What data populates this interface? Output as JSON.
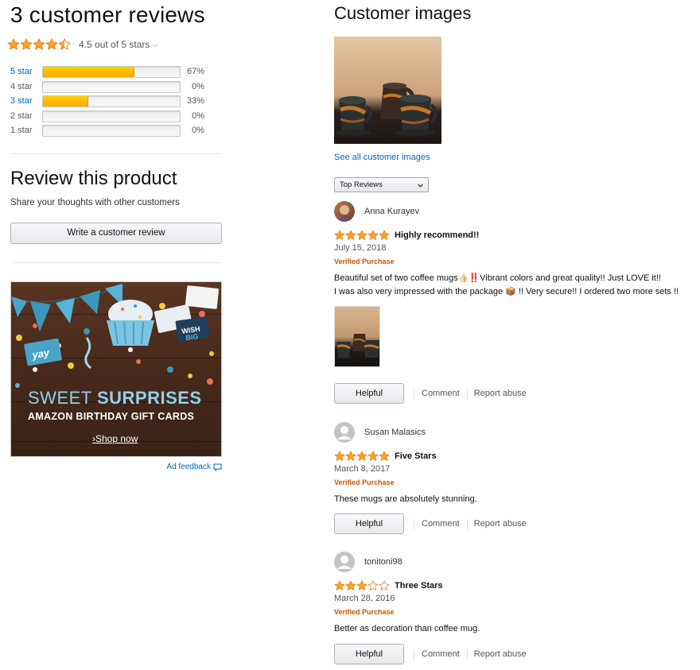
{
  "summary": {
    "title": "3 customer reviews",
    "rating_value": 4.5,
    "rating_text": "4.5 out of 5 stars",
    "histogram": [
      {
        "label": "5 star",
        "percent": 67,
        "percent_text": "67%",
        "linked": true
      },
      {
        "label": "4 star",
        "percent": 0,
        "percent_text": "0%",
        "linked": false
      },
      {
        "label": "3 star",
        "percent": 33,
        "percent_text": "33%",
        "linked": true
      },
      {
        "label": "2 star",
        "percent": 0,
        "percent_text": "0%",
        "linked": false
      },
      {
        "label": "1 star",
        "percent": 0,
        "percent_text": "0%",
        "linked": false
      }
    ]
  },
  "review_product": {
    "title": "Review this product",
    "subtitle": "Share your thoughts with other customers",
    "button_label": "Write a customer review"
  },
  "ad": {
    "headline_light": "SWEET ",
    "headline_bold": "SURPRISES",
    "subline": "AMAZON BIRTHDAY GIFT CARDS",
    "cta": "Shop now",
    "feedback_label": "Ad feedback"
  },
  "customer_images": {
    "title": "Customer images",
    "see_all": "See all customer images"
  },
  "sort": {
    "selected": "Top Reviews"
  },
  "reviews": [
    {
      "author": "Anna Kurayev",
      "stars": 5,
      "title": "Highly recommend!!",
      "date": "July 15, 2018",
      "verified": "Verified Purchase",
      "body_line1": "Beautiful set of two coffee mugs👍🏻‼️Vibrant colors and great quality!! Just LOVE it!!",
      "body_line2": "I was also very impressed with the package 📦 !! Very secure!! I ordered two more sets !!",
      "helpful": "Helpful",
      "comment": "Comment",
      "report": "Report abuse"
    },
    {
      "author": "Susan Malasics",
      "stars": 5,
      "title": "Five Stars",
      "date": "March 8, 2017",
      "verified": "Verified Purchase",
      "body_line1": "These mugs are absolutely stunning.",
      "helpful": "Helpful",
      "comment": "Comment",
      "report": "Report abuse"
    },
    {
      "author": "tonitoni98",
      "stars": 3,
      "title": "Three Stars",
      "date": "March 28, 2016",
      "verified": "Verified Purchase",
      "body_line1": "Better as decoration than coffee mug.",
      "helpful": "Helpful",
      "comment": "Comment",
      "report": "Report abuse"
    }
  ],
  "colors": {
    "link": "#0066c0",
    "star": "#ffa41c",
    "bar_fill": "#ffb300",
    "verified": "#c45500"
  }
}
